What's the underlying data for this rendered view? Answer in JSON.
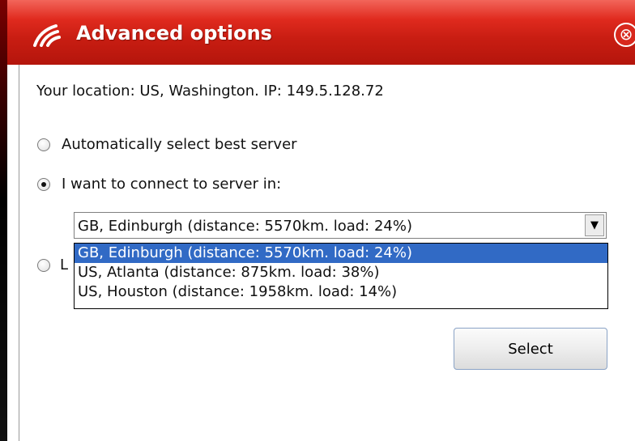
{
  "window": {
    "title": "Advanced options",
    "accent_color": "#c81d12",
    "logo_icon": "signal-waves-icon",
    "close_icon": "close-circle-icon",
    "close_glyph": "⊗"
  },
  "location": {
    "text": "Your location: US, Washington.  IP: 149.5.128.72"
  },
  "options": {
    "auto": {
      "label": "Automatically select best server",
      "checked": false
    },
    "manual": {
      "label": "I want to connect to server in:",
      "checked": true
    },
    "third": {
      "label_visible": "L",
      "checked": false
    }
  },
  "server_select": {
    "selected_value": "GB, Edinburgh (distance: 5570km. load: 24%)",
    "arrow_glyph": "▼",
    "options": [
      "GB, Edinburgh (distance: 5570km. load: 24%)",
      "US, Atlanta (distance: 875km. load: 38%)",
      "US, Houston (distance: 1958km. load: 14%)"
    ],
    "highlight_color": "#316ac5"
  },
  "buttons": {
    "select_label": "Select"
  }
}
